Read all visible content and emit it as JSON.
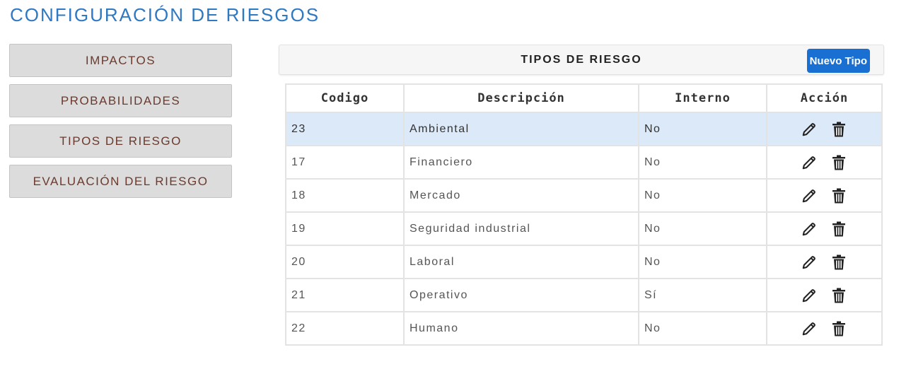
{
  "page": {
    "title": "CONFIGURACIÓN DE RIESGOS"
  },
  "sidebar": {
    "items": [
      {
        "label": "IMPACTOS"
      },
      {
        "label": "PROBABILIDADES"
      },
      {
        "label": "TIPOS DE RIESGO"
      },
      {
        "label": "EVALUACIÓN DEL RIESGO"
      }
    ]
  },
  "panel": {
    "title": "TIPOS DE RIESGO",
    "new_button_label": "Nuevo Tipo"
  },
  "table": {
    "headers": [
      "Codigo",
      "Descripción",
      "Interno",
      "Acción"
    ],
    "selected_index": 0,
    "rows": [
      {
        "codigo": "23",
        "descripcion": "Ambiental",
        "interno": "No"
      },
      {
        "codigo": "17",
        "descripcion": "Financiero",
        "interno": "No"
      },
      {
        "codigo": "18",
        "descripcion": "Mercado",
        "interno": "No"
      },
      {
        "codigo": "19",
        "descripcion": "Seguridad industrial",
        "interno": "No"
      },
      {
        "codigo": "20",
        "descripcion": "Laboral",
        "interno": "No"
      },
      {
        "codigo": "21",
        "descripcion": "Operativo",
        "interno": "Sí"
      },
      {
        "codigo": "22",
        "descripcion": "Humano",
        "interno": "No"
      }
    ],
    "row_actions": [
      "pencil-icon",
      "trash-icon"
    ]
  },
  "colors": {
    "title": "#2f78c2",
    "primary_button": "#1a6fd3",
    "selected_row": "#dbe9f9",
    "sidebar_text": "#6b3a2e"
  }
}
